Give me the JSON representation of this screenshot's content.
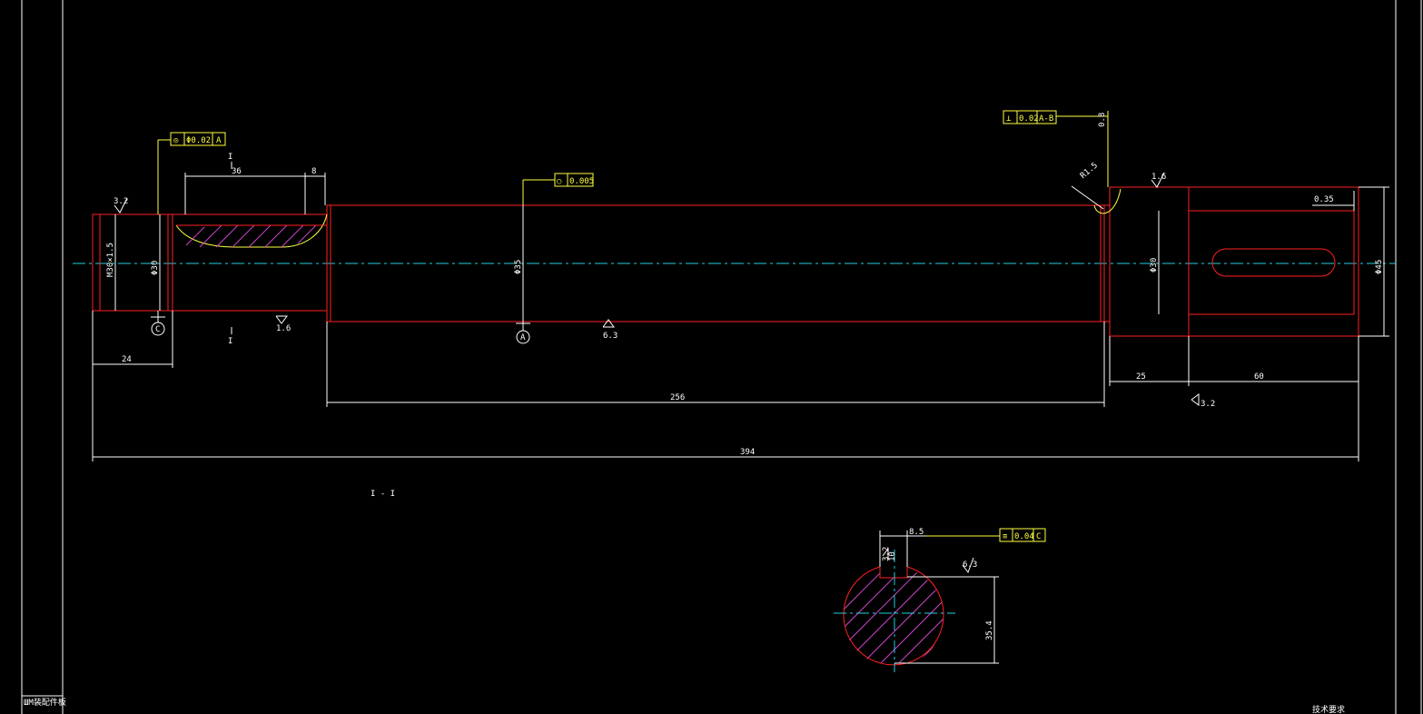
{
  "drawing": {
    "title_block_label": "ШМ装配件板",
    "bottom_note": "技术要求",
    "section_label": "I - I",
    "section_mark": "I",
    "datums": {
      "a": "A",
      "b": "B",
      "c": "C"
    }
  },
  "tolerance_frames": {
    "coaxiality": {
      "symbol": "◎",
      "value": "Φ0.02",
      "datum": "A"
    },
    "roundness": {
      "symbol": "○",
      "value": "0.005"
    },
    "perpendicularity": {
      "symbol": "⊥",
      "value": "0.02",
      "datum": "A-B"
    },
    "symmetry": {
      "symbol": "≡",
      "value": "0.04",
      "datum": "C"
    }
  },
  "dimensions": {
    "overall_length": "394",
    "main_length": "256",
    "left_end": "24",
    "keyway_len": "36",
    "keyway_off": "8",
    "step_len": "25",
    "right_end": "60",
    "thread": "M30×1.5",
    "d_left": "Φ30",
    "d_main": "Φ35",
    "d_right_step": "Φ30",
    "d_right_end": "Φ45",
    "chamfer": "0.35",
    "groove": "R1.5",
    "section_key": "8.5",
    "section_depth": "35.4",
    "section_width": "10"
  },
  "roughness": {
    "r1": "3.2",
    "r2": "1.6",
    "r3": "6.3",
    "r4": "1.6",
    "r5": "3.2",
    "r6": "0.8",
    "r7": "6.3",
    "r8": "3.2"
  }
}
